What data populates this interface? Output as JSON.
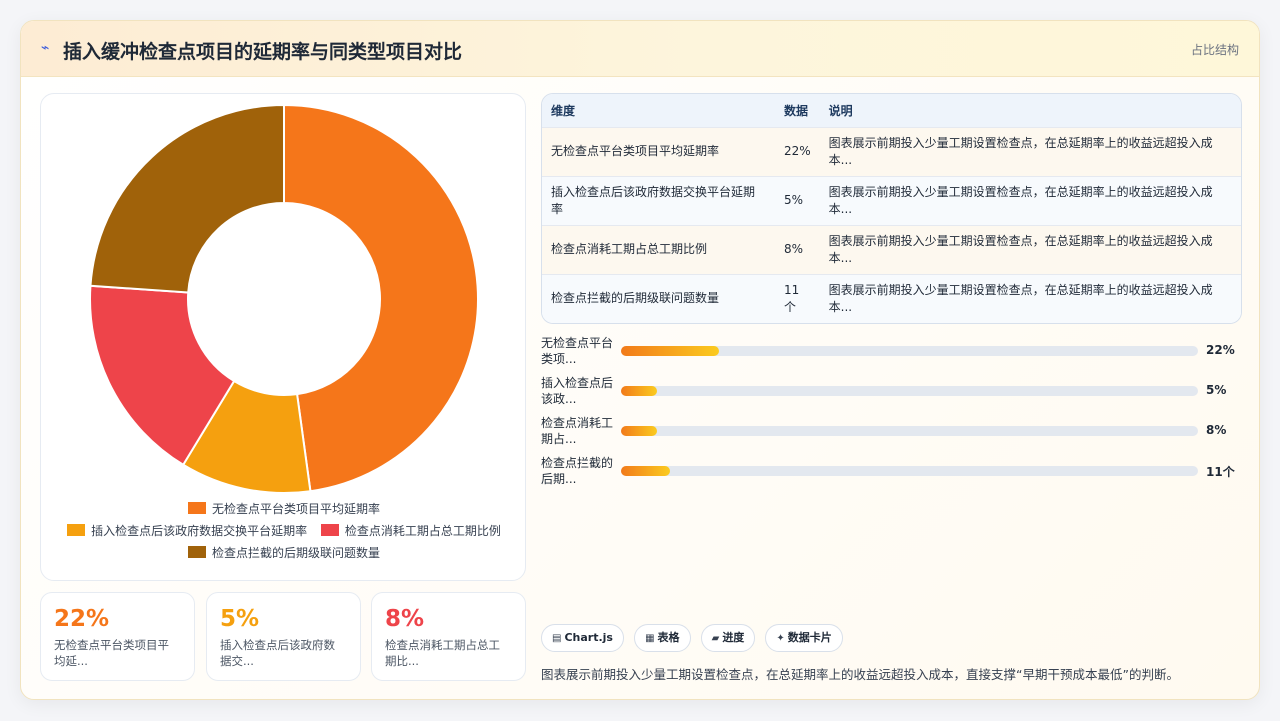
{
  "header": {
    "title_icon": "chart-trend-icon",
    "title": "插入缓冲检查点项目的延期率与同类型项目对比",
    "tag": "占比结构"
  },
  "colors": {
    "orange": "#f5761a",
    "amber": "#f5a00f",
    "red": "#ee444a",
    "brown": "#a0620a"
  },
  "chart_data": {
    "type": "pie",
    "variant": "doughnut",
    "categories": [
      "无检查点平台类项目平均延期率",
      "插入检查点后该政府数据交换平台延期率",
      "检查点消耗工期占总工期比例",
      "检查点拦截的后期级联问题数量"
    ],
    "values": [
      22,
      5,
      8,
      11
    ],
    "colors": [
      "#f5761a",
      "#f5a00f",
      "#ee444a",
      "#a0620a"
    ],
    "legend_placement": "bottom"
  },
  "legend": [
    {
      "label": "无检查点平台类项目平均延期率",
      "color": "#f5761a"
    },
    {
      "label": "插入检查点后该政府数据交换平台延期率",
      "color": "#f5a00f"
    },
    {
      "label": "检查点消耗工期占总工期比例",
      "color": "#ee444a"
    },
    {
      "label": "检查点拦截的后期级联问题数量",
      "color": "#a0620a"
    }
  ],
  "stats": [
    {
      "value": "22%",
      "label": "无检查点平台类项目平",
      "label2": "均延...",
      "color": "#f5761a"
    },
    {
      "value": "5%",
      "label": "插入检查点后该政府数",
      "label2": "据交...",
      "color": "#f5a00f"
    },
    {
      "value": "8%",
      "label": "检查点消耗工期占总工",
      "label2": "期比...",
      "color": "#ee444a"
    }
  ],
  "table": {
    "headers": [
      "维度",
      "数据",
      "说明"
    ],
    "rows": [
      {
        "dim": "无检查点平台类项目平均延期率",
        "dim2": "",
        "data": "22%",
        "desc": "图表展示前期投入少量工期设置检查点，在总延期率上的收益远超投入成",
        "desc2": "本..."
      },
      {
        "dim": "插入检查点后该政府数据交换平台延期",
        "dim2": "率",
        "data": "5%",
        "desc": "图表展示前期投入少量工期设置检查点，在总延期率上的收益远超投入成",
        "desc2": "本..."
      },
      {
        "dim": "检查点消耗工期占总工期比例",
        "dim2": "",
        "data": "8%",
        "desc": "图表展示前期投入少量工期设置检查点，在总延期率上的收益远超投入成",
        "desc2": "本..."
      },
      {
        "dim": "检查点拦截的后期级联问题数量",
        "dim2": "",
        "data": "11个",
        "desc": "图表展示前期投入少量工期设置检查点，在总延期率上的收益远超投入成",
        "desc2": "本..."
      }
    ]
  },
  "progress": [
    {
      "label": "无检查点平台",
      "label2": "类项...",
      "value": "22%",
      "fraction": 0.17
    },
    {
      "label": "插入检查点后",
      "label2": "该政...",
      "value": "5%",
      "fraction": 0.062
    },
    {
      "label": "检查点消耗工",
      "label2": "期占...",
      "value": "8%",
      "fraction": 0.062
    },
    {
      "label": "检查点拦截的",
      "label2": "后期...",
      "value": "11个",
      "fraction": 0.085
    }
  ],
  "chips": [
    {
      "icon": "table-icon",
      "glyph": "▤",
      "label": "Chart.js"
    },
    {
      "icon": "grid-icon",
      "glyph": "▦",
      "label": "表格"
    },
    {
      "icon": "folder-icon",
      "glyph": "▰",
      "label": "进度"
    },
    {
      "icon": "sparkle-icon",
      "glyph": "✦",
      "label": "数据卡片"
    }
  ],
  "caption": "图表展示前期投入少量工期设置检查点，在总延期率上的收益远超投入成本，直接支撑“早期干预成本最低”的判断。"
}
